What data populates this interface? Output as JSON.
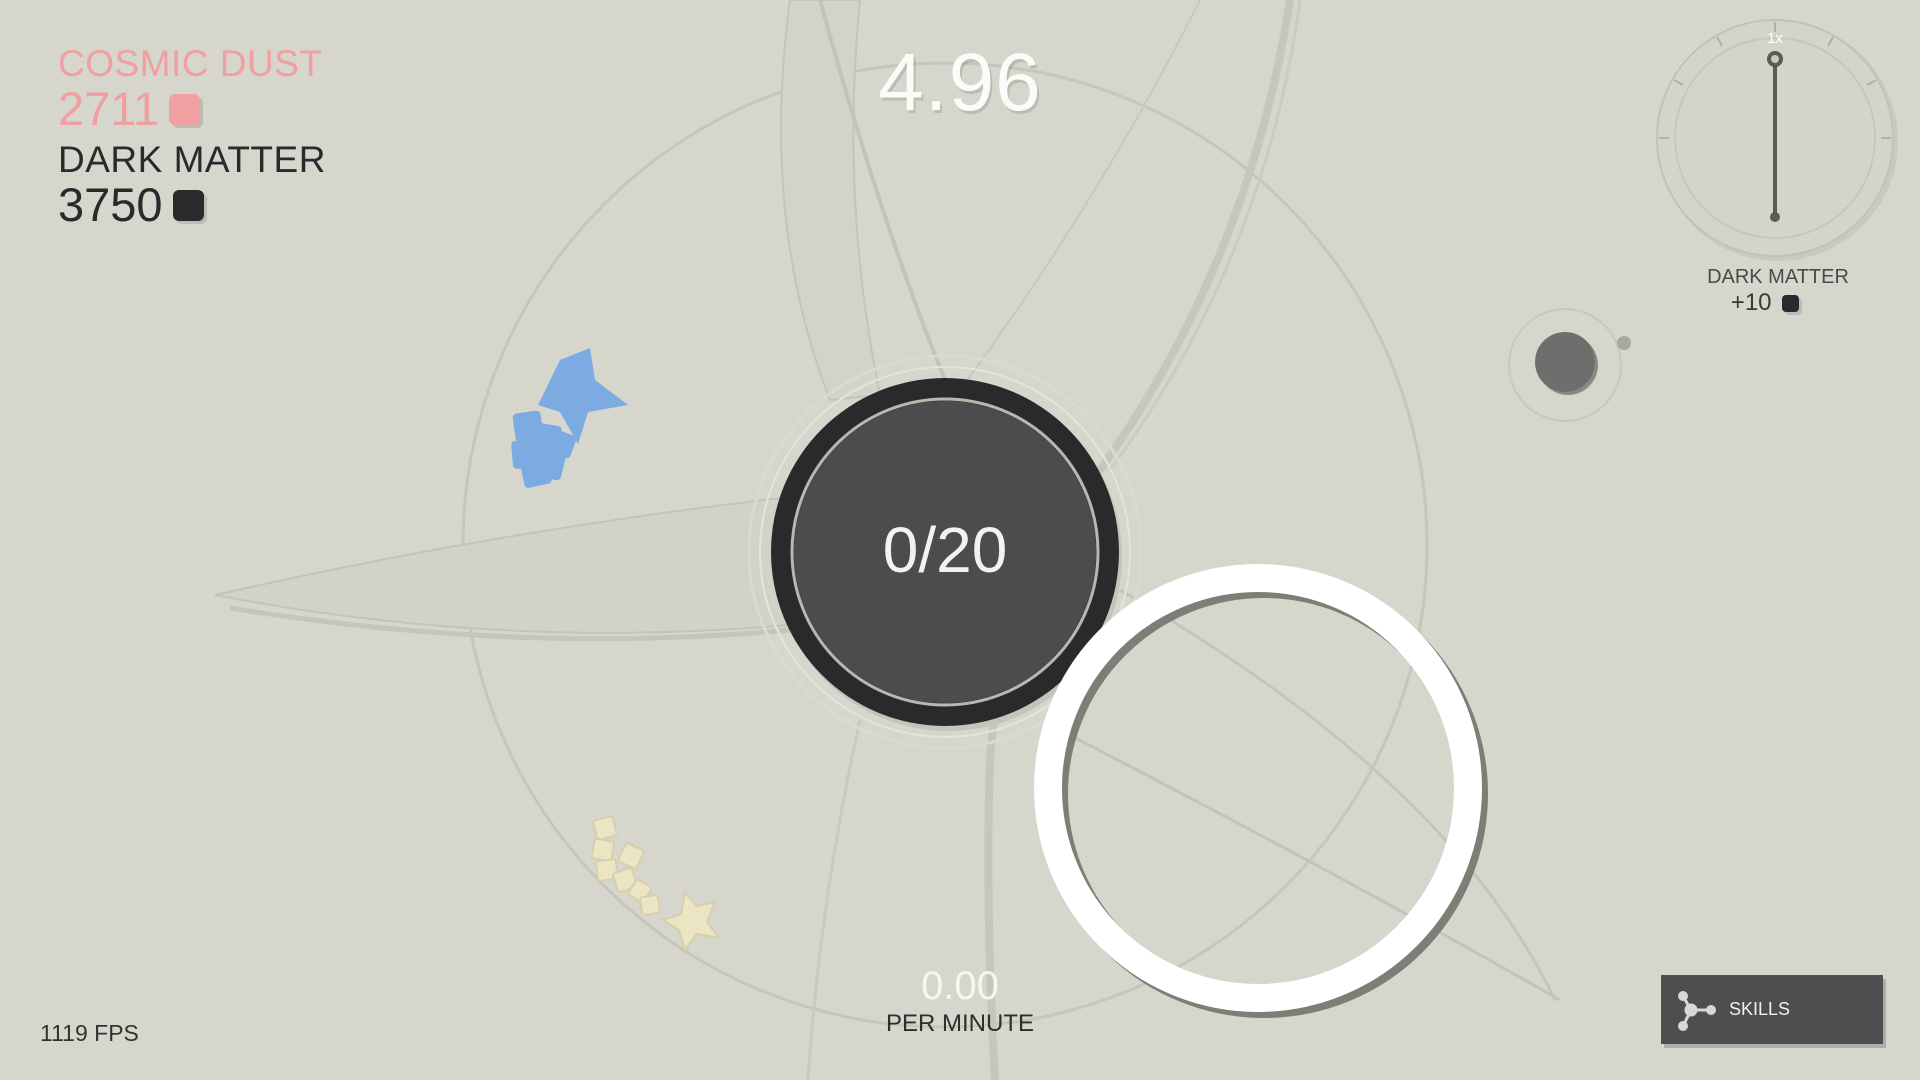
{
  "resources": {
    "cosmic_dust": {
      "label": "COSMIC DUST",
      "value": "2711",
      "color": "#f0a0a0"
    },
    "dark_matter": {
      "label": "DARK MATTER",
      "value": "3750",
      "color": "#2a2a2c"
    }
  },
  "timer": {
    "value": "4.96"
  },
  "center_orb": {
    "progress": "0/20",
    "color": "#4c4c4e",
    "ring_color": "#2a2a2c"
  },
  "rate": {
    "value": "0.00",
    "label": "PER MINUTE"
  },
  "fps": {
    "label": "1119 FPS"
  },
  "speed_gauge": {
    "speed_label": "1x",
    "title": "DARK MATTER",
    "bonus": "+10"
  },
  "skills_button": {
    "label": "SKILLS",
    "icon": "skill-tree-icon"
  },
  "clusters": {
    "blue": {
      "color": "#6da4e6"
    },
    "cream": {
      "color": "#ece5c4"
    }
  },
  "colors": {
    "background": "#d6d6cd",
    "highlight": "#ffffff"
  }
}
